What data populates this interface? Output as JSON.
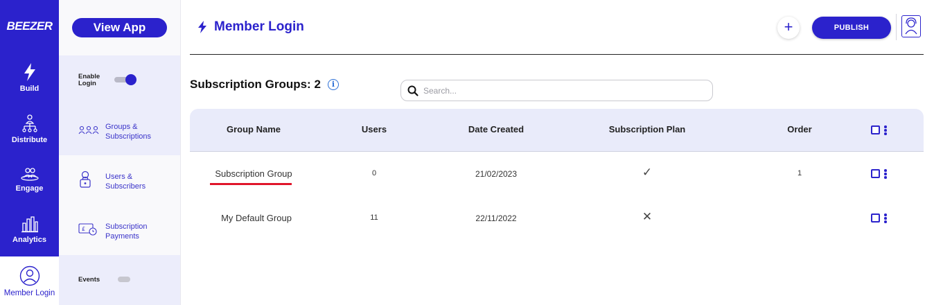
{
  "rail": {
    "logo": "BEEZER",
    "items": [
      {
        "label": "Build",
        "icon": "bolt-icon"
      },
      {
        "label": "Distribute",
        "icon": "hierarchy-icon"
      },
      {
        "label": "Engage",
        "icon": "people-icon"
      },
      {
        "label": "Analytics",
        "icon": "bar-chart-icon"
      },
      {
        "label": "Member Login",
        "icon": "user-circle-icon",
        "active": true
      }
    ]
  },
  "sidebar": {
    "view_app": "View App",
    "enable_login_line1": "Enable",
    "enable_login_line2": "Login",
    "enable_login_on": true,
    "items": [
      {
        "label_line1": "Groups &",
        "label_line2": "Subscriptions",
        "icon": "group-icon"
      },
      {
        "label_line1": "Users &",
        "label_line2": "Subscribers",
        "icon": "user-lock-icon"
      },
      {
        "label_line1": "Subscription",
        "label_line2": "Payments",
        "icon": "payment-icon"
      }
    ],
    "events_label": "Events",
    "events_on": false
  },
  "header": {
    "title": "Member Login",
    "plus_label": "+",
    "publish_label": "PUBLISH"
  },
  "section": {
    "title": "Subscription Groups: 2",
    "info_glyph": "i"
  },
  "search": {
    "placeholder": "Search..."
  },
  "table": {
    "columns": [
      "Group Name",
      "Users",
      "Date Created",
      "Subscription Plan",
      "Order"
    ],
    "rows": [
      {
        "group_name": "Subscription Group",
        "users": "0",
        "date_created": "21/02/2023",
        "plan": "✓",
        "order": "1"
      },
      {
        "group_name": "My Default Group",
        "users": "11",
        "date_created": "22/11/2022",
        "plan": "✕",
        "order": ""
      }
    ]
  },
  "colors": {
    "brand": "#2b22cc",
    "highlight": "#e0152a"
  }
}
